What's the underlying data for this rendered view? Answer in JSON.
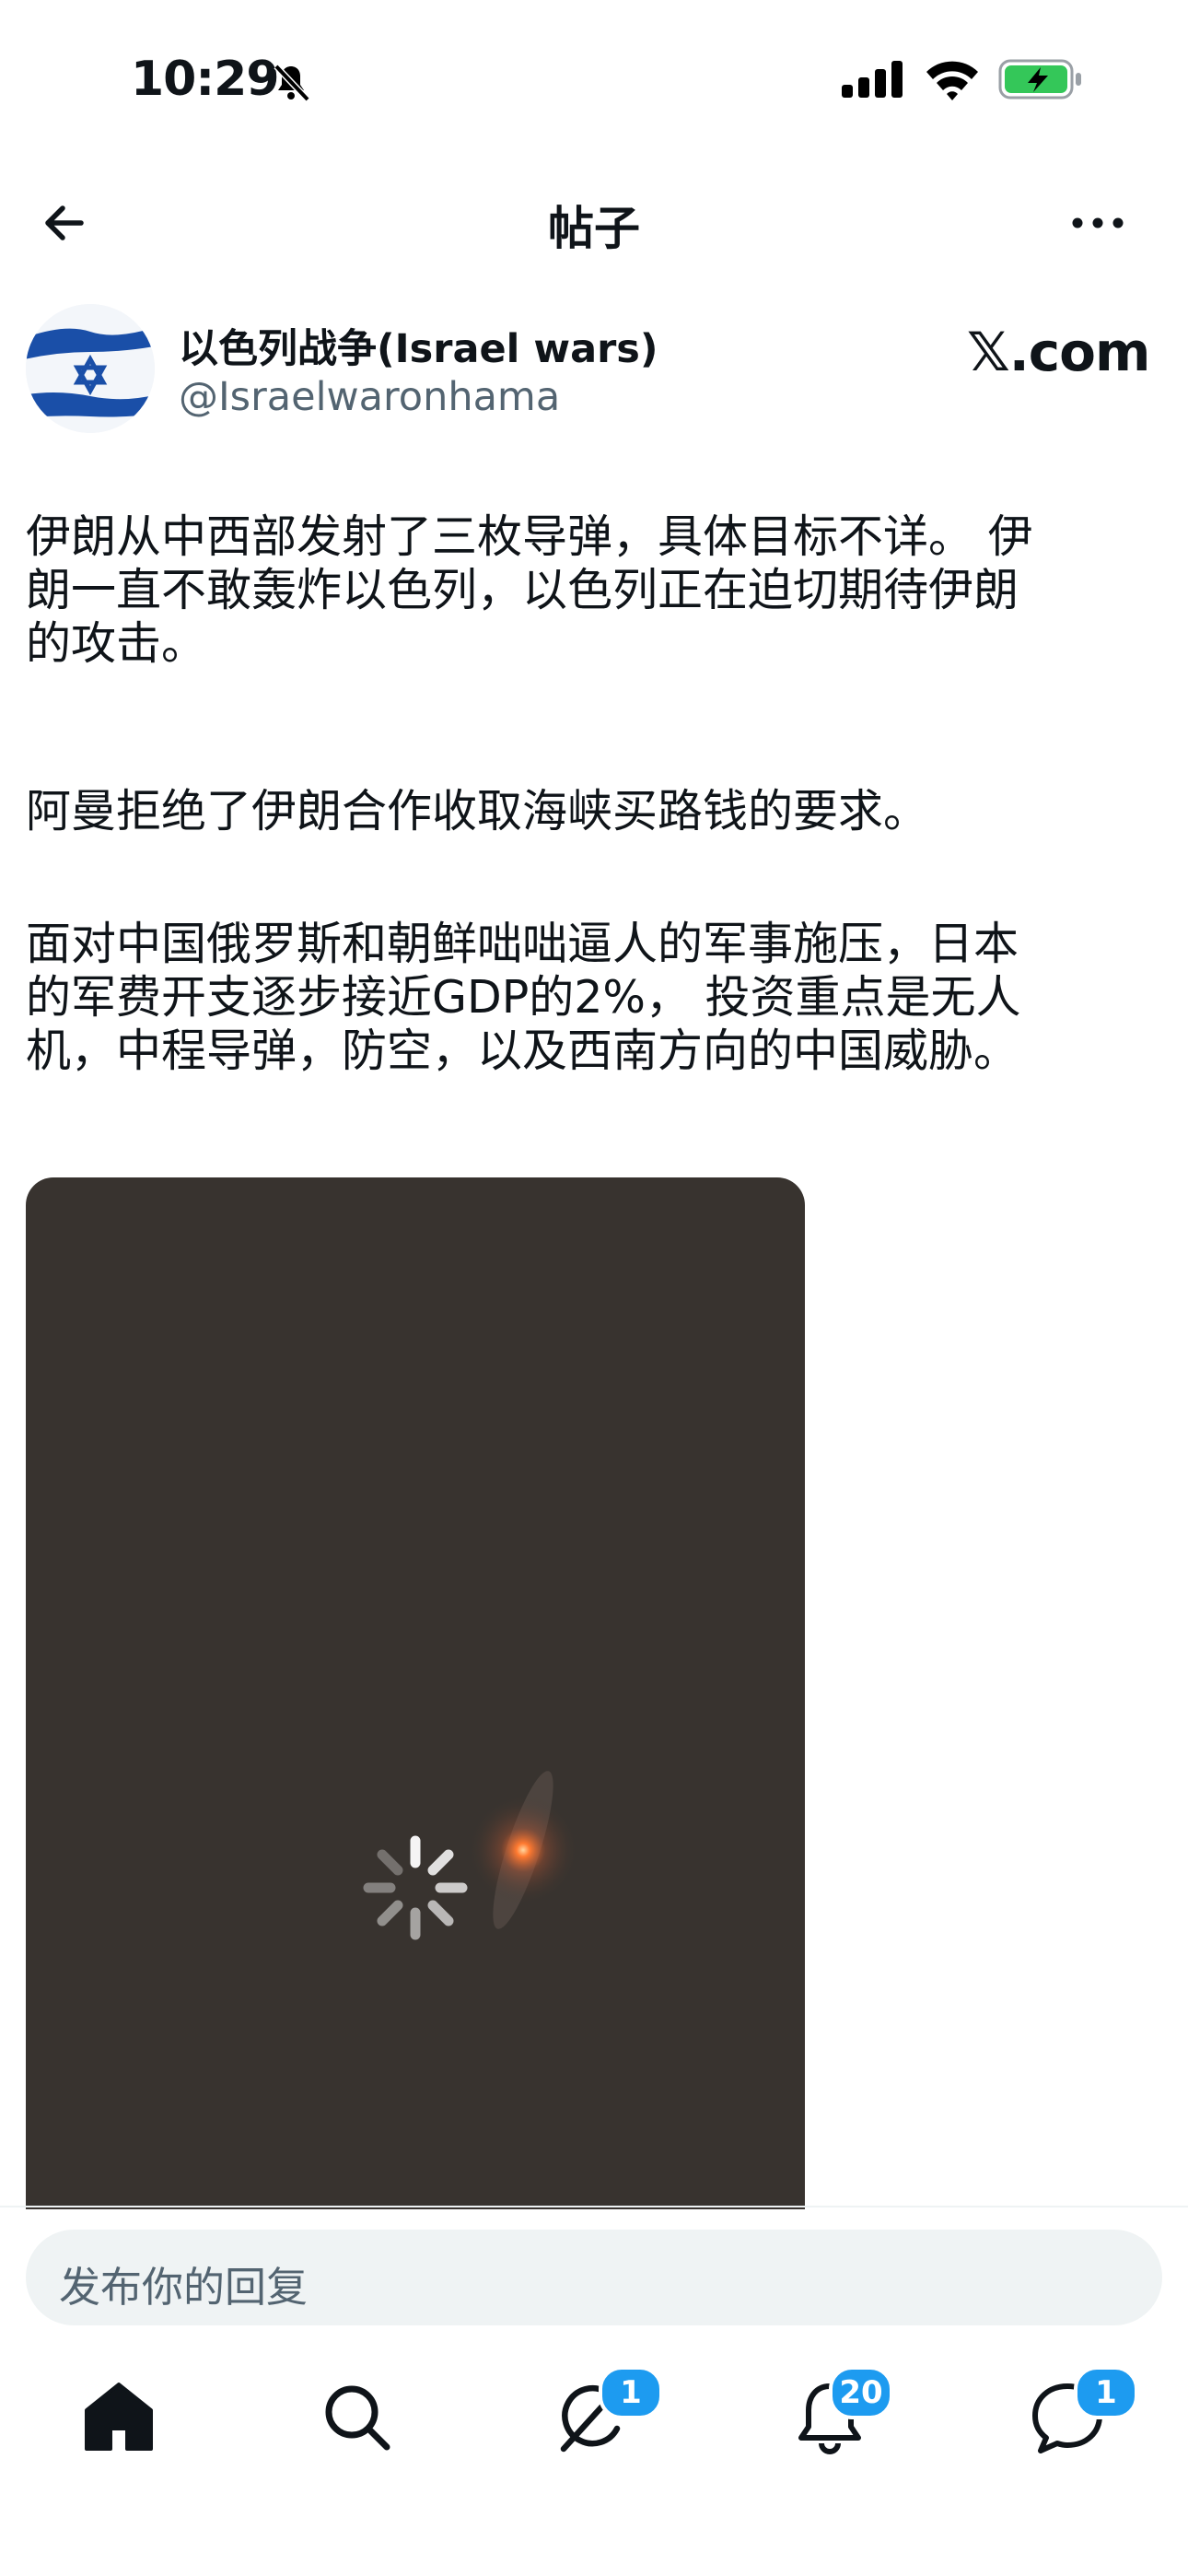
{
  "status_bar": {
    "time": "10:29"
  },
  "header": {
    "title": "帖子"
  },
  "post": {
    "author_name": "以色列战争(Israel wars)",
    "author_handle": "@Israelwaronhama",
    "source": "𝕏.com",
    "paragraphs": [
      "伊朗从中西部发射了三枚导弹，具体目标不详。 伊\n朗一直不敢轰炸以色列，以色列正在迫切期待伊朗\n的攻击。",
      "阿曼拒绝了伊朗合作收取海峡买路钱的要求。",
      "面对中国俄罗斯和朝鲜咄咄逼人的军事施压，日本\n的军费开支逐步接近GDP的2%， 投资重点是无人\n机，中程导弹，防空，以及西南方向的中国威胁。"
    ]
  },
  "reply": {
    "placeholder": "发布你的回复"
  },
  "tab_bar": {
    "grok_badge": "1",
    "notifications_badge": "20",
    "messages_badge": "1"
  },
  "icons": [
    "bell-muted-icon",
    "signal-icon",
    "wifi-icon",
    "battery-charging-icon",
    "back-arrow-icon",
    "more-icon",
    "israel-flag-avatar",
    "loading-spinner-icon",
    "home-icon",
    "search-icon",
    "grok-icon",
    "notifications-icon",
    "messages-icon"
  ],
  "colors": {
    "accent": "#1d9bf0",
    "secondary_text": "#536471",
    "media_bg": "#38332f"
  }
}
